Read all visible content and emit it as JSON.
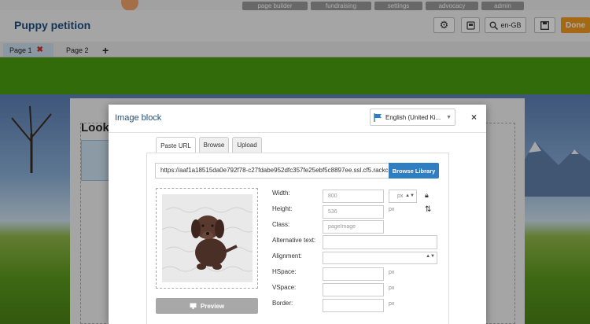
{
  "app": {
    "title": "Puppy petition",
    "top_nav": [
      "page builder",
      "fundraising",
      "settings",
      "advocacy",
      "admin"
    ],
    "language_code": "en-GB",
    "done_label": "Done"
  },
  "page_tabs": [
    {
      "label": "Page 1",
      "active": true
    },
    {
      "label": "Page 2",
      "active": false
    }
  ],
  "content": {
    "heading": "Look"
  },
  "modal": {
    "title": "Image block",
    "language": "English (United Ki...",
    "close": "×",
    "tabs": [
      {
        "label": "Paste URL",
        "active": true
      },
      {
        "label": "Browse",
        "active": false
      },
      {
        "label": "Upload",
        "active": false
      }
    ],
    "url_value": "https://aaf1a18515da0e792f78-c27fdabe952dfc357fe25ebf5c8897ee.ssl.cf5.rackcdn.com",
    "browse_library_label": "Browse Library",
    "preview_label": "Preview",
    "fields": {
      "width_label": "Width:",
      "width_value": "800",
      "unit_value": "px",
      "height_label": "Height:",
      "height_value": "536",
      "height_unit": "px",
      "class_label": "Class:",
      "class_value": "pageImage",
      "alt_label": "Alternative text:",
      "alignment_label": "Alignment:",
      "hspace_label": "HSpace:",
      "hspace_unit": "px",
      "vspace_label": "VSpace:",
      "vspace_unit": "px",
      "border_label": "Border:",
      "border_unit": "px"
    }
  },
  "colors": {
    "accent_blue": "#2f7ec1",
    "title_blue": "#1c4e80",
    "done_orange": "#f39a1e",
    "green_band": "#4aa010"
  }
}
